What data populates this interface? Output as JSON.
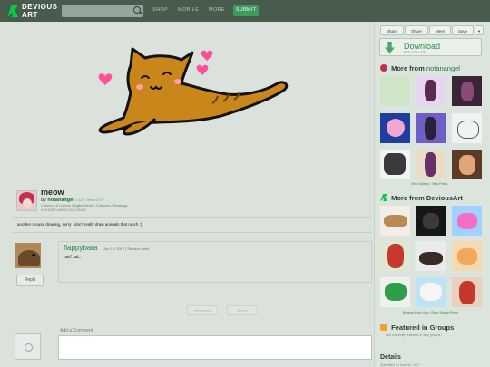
{
  "header": {
    "logo_line1": "DEVIOUS",
    "logo_line2": "ART",
    "nav": [
      "SHOP",
      "MOBILE",
      "MORE"
    ],
    "submit": "SUBMIT"
  },
  "deviation": {
    "title": "meow",
    "by": "by",
    "author": "notanangel",
    "time": "1,627 Views 2017",
    "category": "Cartoons & Comics / Digital Media / Cartoons / Drawings",
    "tags": "#CATART #ARTCHALLENGE",
    "description": "another mouse drawing, sorry i don't really draw animals that much :)"
  },
  "comment": {
    "username": "flappybara",
    "meta": "Jun 19, 2017  |  Student Artist",
    "text": "barf cat..",
    "reply": "Reply"
  },
  "pagination": {
    "prev": "◂ Previous",
    "next": "Next ▸"
  },
  "add_comment": {
    "label": "Add a Comment:"
  },
  "sidebar": {
    "buttons": [
      "Share",
      "Share",
      "Meet",
      "Save"
    ],
    "download": {
      "label": "Download",
      "size": "PNG 433 x 526"
    },
    "more_from_author": {
      "prefix": "More from",
      "name": "notanangel",
      "note": "View Gallery  •  View Prints"
    },
    "more_from_site": {
      "title": "More from DeviousArt",
      "note": "Browse More Like  •  Shop Similar Prints"
    },
    "groups": {
      "title": "Featured in Groups",
      "note": "Not currently featured in any groups"
    },
    "details": {
      "title": "Details",
      "row": "Submitted on     June 19, 2017"
    }
  },
  "colors": {
    "header": "#475c4d",
    "accent_green": "#05cc47",
    "submit": "#3d9b5d"
  }
}
